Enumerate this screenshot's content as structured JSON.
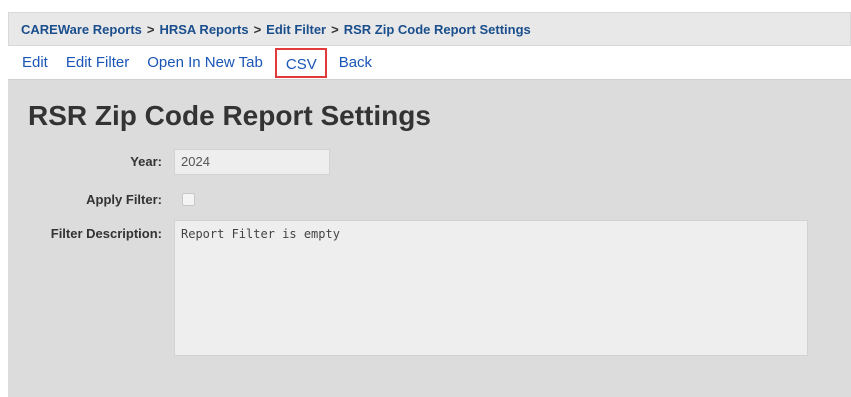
{
  "breadcrumb": {
    "items": [
      "CAREWare Reports",
      "HRSA Reports",
      "Edit Filter"
    ],
    "separator": ">",
    "current": "RSR Zip Code Report Settings"
  },
  "toolbar": {
    "edit": "Edit",
    "edit_filter": "Edit Filter",
    "open_new_tab": "Open In New Tab",
    "csv": "CSV",
    "back": "Back"
  },
  "page": {
    "title": "RSR Zip Code Report Settings"
  },
  "form": {
    "year_label": "Year:",
    "year_value": "2024",
    "apply_filter_label": "Apply Filter:",
    "apply_filter_checked": false,
    "filter_description_label": "Filter Description:",
    "filter_description_value": "Report Filter is empty"
  },
  "colors": {
    "link": "#1a55b8",
    "breadcrumb_link": "#1a4e8c",
    "highlight_border": "#e03a3a",
    "content_bg": "#dcdcdc"
  }
}
